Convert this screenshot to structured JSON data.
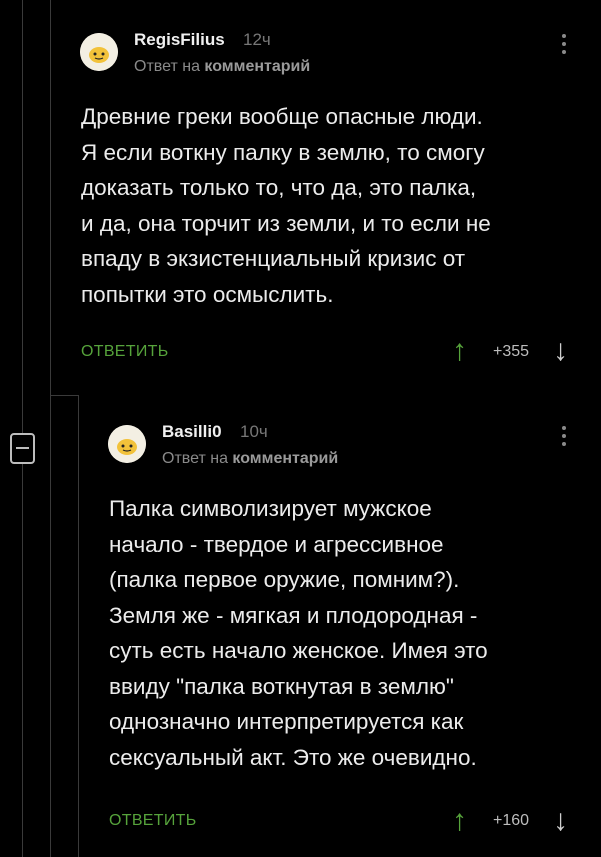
{
  "comments": [
    {
      "author": "RegisFilius",
      "time": "12ч",
      "reply_prefix": "Ответ на",
      "reply_target": "комментарий",
      "lines": [
        "Древние греки вообще опасные люди.",
        "Я если воткну палку в землю, то смогу",
        "доказать только то, что да, это палка,",
        "и да, она торчит из земли, и то если не",
        "впаду в экзистенциальный кризис от",
        "попытки это осмыслить."
      ],
      "reply_label": "ОТВЕТИТЬ",
      "score": "+355",
      "up_icon": "arrow-up-icon",
      "down_icon": "arrow-down-icon"
    },
    {
      "author": "Basilli0",
      "time": "10ч",
      "reply_prefix": "Ответ на",
      "reply_target": "комментарий",
      "lines": [
        "Палка символизирует мужское",
        "начало - твердое и агрессивное",
        "(палка первое оружие, помним?).",
        "Земля же - мягкая и плодородная -",
        "суть есть начало женское. Имея это",
        "ввиду \"палка воткнутая в землю\"",
        "однозначно интерпретируется как",
        "сексуальный акт. Это же очевидно."
      ],
      "reply_label": "ОТВЕТИТЬ",
      "score": "+160",
      "up_icon": "arrow-up-icon",
      "down_icon": "arrow-down-icon"
    }
  ],
  "colors": {
    "background": "#000000",
    "accent_green": "#56a33b",
    "text": "#ececec",
    "muted": "#8a8a8a"
  }
}
